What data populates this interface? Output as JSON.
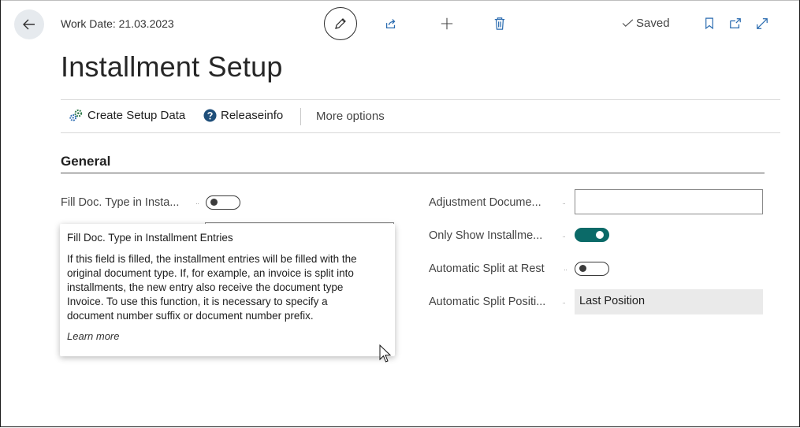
{
  "header": {
    "work_date": "Work Date: 21.03.2023",
    "saved_label": "Saved"
  },
  "page": {
    "title": "Installment Setup"
  },
  "actions": {
    "create_setup_data": "Create Setup Data",
    "releaseinfo": "Releaseinfo",
    "more_options": "More options"
  },
  "section": {
    "title": "General"
  },
  "fields": {
    "fill_doc_type": {
      "label": "Fill Doc. Type in Insta...",
      "value": false
    },
    "adjustment_document": {
      "label": "Adjustment Docume...",
      "value": ""
    },
    "only_show_installments": {
      "label": "Only Show Installme...",
      "value": true
    },
    "automatic_split_at_rest": {
      "label": "Automatic Split at Rest",
      "value": false
    },
    "automatic_split_position": {
      "label": "Automatic Split Positi...",
      "value": "Last Position"
    }
  },
  "tooltip": {
    "title": "Fill Doc. Type in Installment Entries",
    "lines": [
      "If this field is filled, the installment entries will be filled with the",
      "original document type. If, for example, an invoice is split into",
      "installments, the new entry also receive the document type",
      "Invoice. To use this function, it is necessary to specify a",
      "document number suffix or document number prefix."
    ],
    "learn_more": "Learn more"
  },
  "colors": {
    "accent_toggle": "#0b6a68",
    "readonly_bg": "#eaeaea",
    "back_button_bg": "#e6eaee",
    "help_icon": "#1f4f7a"
  },
  "icons": {
    "back": "arrow-left-icon",
    "edit": "pencil-icon",
    "share": "share-icon",
    "new": "plus-icon",
    "delete": "trash-icon",
    "saved": "checkmark-icon",
    "bookmark": "bookmark-icon",
    "open_new_window": "open-new-window-icon",
    "expand": "expand-icon",
    "create_setup": "gears-icon",
    "releaseinfo": "help-icon"
  }
}
